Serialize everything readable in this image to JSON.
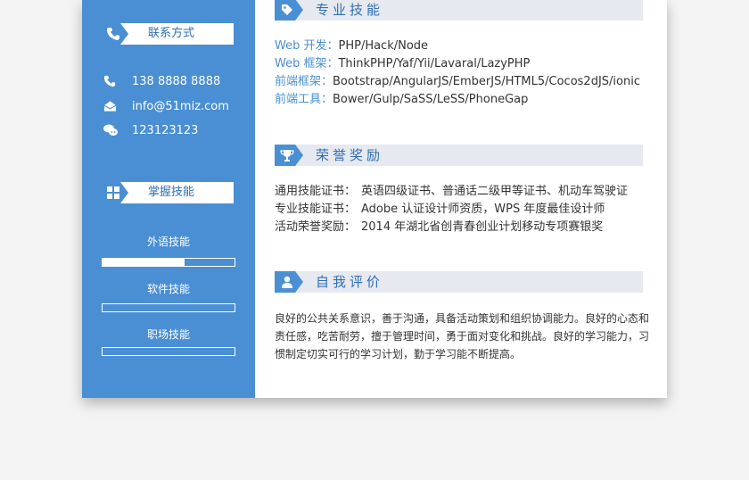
{
  "contact": {
    "header": "联系方式",
    "phone": "138 8888 8888",
    "email": "info@51miz.com",
    "wechat": "123123123"
  },
  "skills_panel": {
    "header": "掌握技能",
    "items": [
      {
        "label": "外语技能",
        "level": 0.62
      },
      {
        "label": "软件技能",
        "level": 0.0
      },
      {
        "label": "职场技能",
        "level": 0.0
      }
    ]
  },
  "professional_skills": {
    "title": "专业技能",
    "items": [
      {
        "key": "Web 开发：",
        "value": "PHP/Hack/Node"
      },
      {
        "key": "Web 框架：",
        "value": "ThinkPHP/Yaf/Yii/Lavaral/LazyPHP"
      },
      {
        "key": "前端框架：",
        "value": "Bootstrap/AngularJS/EmberJS/HTML5/Cocos2dJS/ionic"
      },
      {
        "key": "前端工具：",
        "value": "Bower/Gulp/SaSS/LeSS/PhoneGap"
      }
    ]
  },
  "honors": {
    "title": "荣誉奖励",
    "items": [
      {
        "key": "通用技能证书：",
        "value": "英语四级证书、普通话二级甲等证书、机动车驾驶证"
      },
      {
        "key": "专业技能证书：",
        "value": "Adobe 认证设计师资质，WPS 年度最佳设计师"
      },
      {
        "key": "活动荣誉奖励：",
        "value": "2014 年湖北省创青春创业计划移动专项赛银奖"
      }
    ]
  },
  "self_evaluation": {
    "title": "自我评价",
    "text": "良好的公共关系意识，善于沟通，具备活动策划和组织协调能力。良好的心态和责任感，吃苦耐劳，擅于管理时间，勇于面对变化和挑战。良好的学习能力，习惯制定切实可行的学习计划，勤于学习能不断提高。"
  },
  "colors": {
    "accent": "#4a8fd4",
    "header_bg": "#e6e9ef"
  }
}
